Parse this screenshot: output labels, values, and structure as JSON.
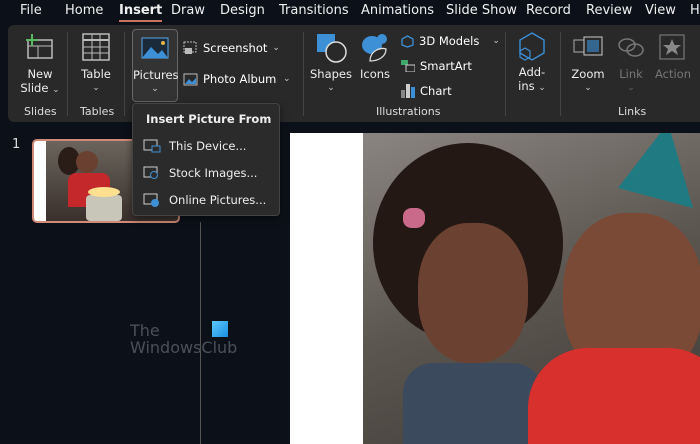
{
  "tabs": [
    "File",
    "Home",
    "Insert",
    "Draw",
    "Design",
    "Transitions",
    "Animations",
    "Slide Show",
    "Record",
    "Review",
    "View",
    "H"
  ],
  "active_tab": "Insert",
  "ribbon": {
    "new_slide": [
      "New",
      "Slide"
    ],
    "table": "Table",
    "pictures": "Pictures",
    "screenshot": "Screenshot",
    "photo_album": "Photo Album",
    "shapes": "Shapes",
    "icons": "Icons",
    "models_3d": "3D Models",
    "smartart": "SmartArt",
    "chart": "Chart",
    "addins": [
      "Add-",
      "ins"
    ],
    "zoom": "Zoom",
    "link": "Link",
    "action": "Action",
    "groups": {
      "slides": "Slides",
      "tables": "Tables",
      "illustrations": "Illustrations",
      "links": "Links"
    }
  },
  "menu": {
    "title": "Insert Picture From",
    "items": [
      "This Device...",
      "Stock Images...",
      "Online Pictures..."
    ]
  },
  "slide_panel": {
    "number": "1"
  },
  "watermark": [
    "The",
    "WindowsClub"
  ],
  "colors": {
    "accent": "#c9735e",
    "icon_blue": "#3d8fd6"
  }
}
